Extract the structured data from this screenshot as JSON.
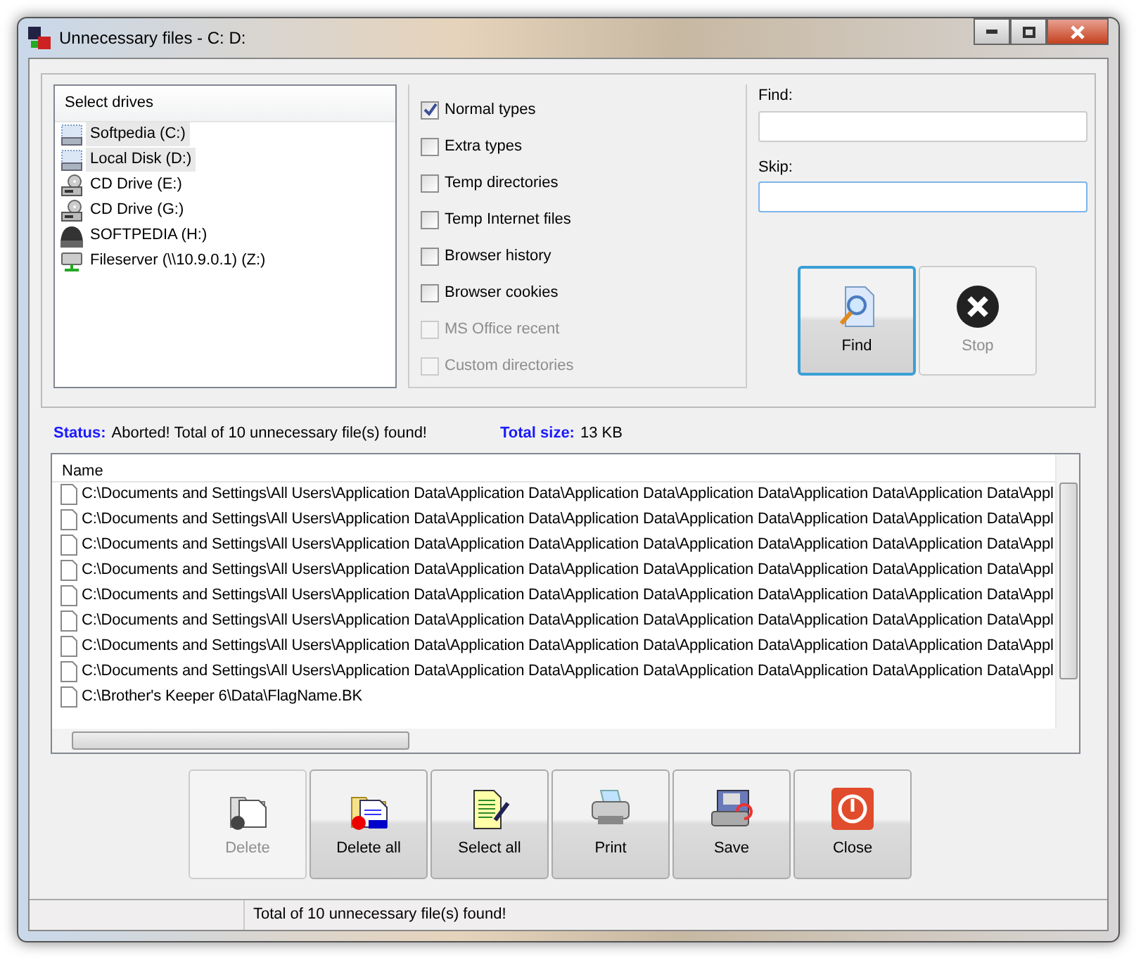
{
  "window": {
    "title": "Unnecessary files - C: D:"
  },
  "drives": {
    "header": "Select drives",
    "items": [
      {
        "label": "Softpedia (C:)",
        "kind": "disk",
        "selected": true
      },
      {
        "label": "Local Disk (D:)",
        "kind": "disk",
        "selected": true
      },
      {
        "label": "CD Drive (E:)",
        "kind": "cd",
        "selected": false
      },
      {
        "label": "CD Drive (G:)",
        "kind": "cd",
        "selected": false
      },
      {
        "label": "SOFTPEDIA (H:)",
        "kind": "removable",
        "selected": false
      },
      {
        "label": "Fileserver (\\\\10.9.0.1) (Z:)",
        "kind": "network",
        "selected": false
      }
    ]
  },
  "options": [
    {
      "label": "Normal types",
      "checked": true,
      "disabled": false
    },
    {
      "label": "Extra types",
      "checked": false,
      "disabled": false
    },
    {
      "label": "Temp directories",
      "checked": false,
      "disabled": false
    },
    {
      "label": "Temp Internet files",
      "checked": false,
      "disabled": false
    },
    {
      "label": "Browser history",
      "checked": false,
      "disabled": false
    },
    {
      "label": "Browser cookies",
      "checked": false,
      "disabled": false
    },
    {
      "label": "MS Office recent",
      "checked": false,
      "disabled": true
    },
    {
      "label": "Custom directories",
      "checked": false,
      "disabled": true
    }
  ],
  "find": {
    "label": "Find:"
  },
  "skip": {
    "label": "Skip:"
  },
  "search_buttons": [
    {
      "label": "Find",
      "kind": "find",
      "disabled": false,
      "selected": true
    },
    {
      "label": "Stop",
      "kind": "stop",
      "disabled": true,
      "selected": false
    }
  ],
  "status": {
    "label": "Status:",
    "text": "Aborted! Total of 10 unnecessary file(s) found!"
  },
  "total_size": {
    "label": "Total size:",
    "text": "13 KB"
  },
  "files": {
    "column": "Name",
    "rows": [
      {
        "path": "C:\\Documents and Settings\\All Users\\Application Data\\Application Data\\Application Data\\Application Data\\Application Data\\Application Data\\Appl"
      },
      {
        "path": "C:\\Documents and Settings\\All Users\\Application Data\\Application Data\\Application Data\\Application Data\\Application Data\\Application Data\\Appl"
      },
      {
        "path": "C:\\Documents and Settings\\All Users\\Application Data\\Application Data\\Application Data\\Application Data\\Application Data\\Application Data\\Appl"
      },
      {
        "path": "C:\\Documents and Settings\\All Users\\Application Data\\Application Data\\Application Data\\Application Data\\Application Data\\Application Data\\Appl"
      },
      {
        "path": "C:\\Documents and Settings\\All Users\\Application Data\\Application Data\\Application Data\\Application Data\\Application Data\\Application Data\\Appl"
      },
      {
        "path": "C:\\Documents and Settings\\All Users\\Application Data\\Application Data\\Application Data\\Application Data\\Application Data\\Application Data\\Appl"
      },
      {
        "path": "C:\\Documents and Settings\\All Users\\Application Data\\Application Data\\Application Data\\Application Data\\Application Data\\Application Data\\Appl"
      },
      {
        "path": "C:\\Documents and Settings\\All Users\\Application Data\\Application Data\\Application Data\\Application Data\\Application Data\\Application Data\\Appl"
      },
      {
        "path": "C:\\Brother's Keeper 6\\Data\\FlagName.BK"
      }
    ]
  },
  "action_buttons": [
    {
      "label": "Delete",
      "kind": "delete",
      "disabled": true
    },
    {
      "label": "Delete all",
      "kind": "delete-all",
      "disabled": false
    },
    {
      "label": "Select all",
      "kind": "select-all",
      "disabled": false
    },
    {
      "label": "Print",
      "kind": "print",
      "disabled": false
    },
    {
      "label": "Save",
      "kind": "save",
      "disabled": false
    },
    {
      "label": "Close",
      "kind": "close",
      "disabled": false
    }
  ],
  "status_bar": {
    "text": "Total of 10 unnecessary file(s) found!"
  }
}
